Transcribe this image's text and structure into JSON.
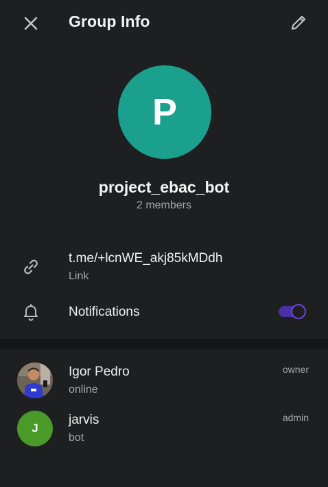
{
  "header": {
    "title": "Group Info",
    "close_icon": "close-icon",
    "edit_icon": "pencil-icon"
  },
  "group": {
    "avatar_letter": "P",
    "avatar_color": "#1aa08d",
    "name": "project_ebac_bot",
    "members_count": "2 members"
  },
  "info": {
    "link_value": "t.me/+lcnWE_akj85kMDdh",
    "link_label": "Link",
    "notifications_label": "Notifications",
    "notifications_enabled": true,
    "toggle_color": "#4b2fa5"
  },
  "members": [
    {
      "name": "Igor Pedro",
      "status": "online",
      "role": "owner",
      "avatar": "photo"
    },
    {
      "name": "jarvis",
      "status": "bot",
      "role": "admin",
      "avatar_letter": "J",
      "avatar_color": "#4a9a2a"
    }
  ]
}
